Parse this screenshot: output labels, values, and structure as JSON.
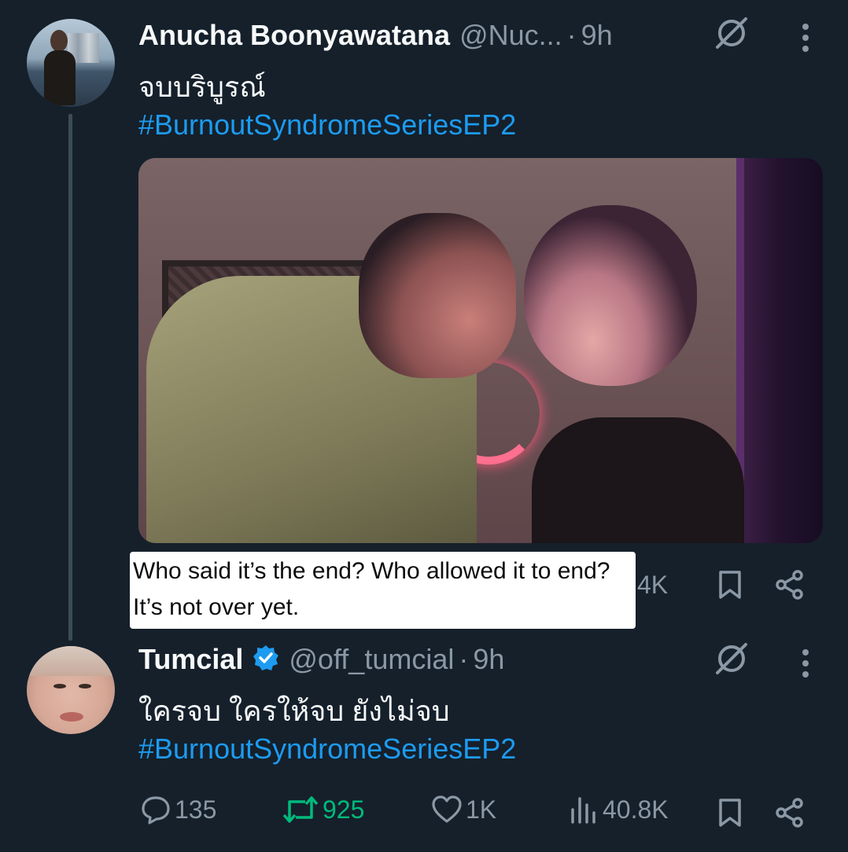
{
  "tweet1": {
    "display_name": "Anucha Boonyawatana",
    "handle": "@Nuc...",
    "separator": "·",
    "time": "9h",
    "text": "จบบริบูรณ์",
    "hashtag": "#BurnoutSyndromeSeriesEP2",
    "partial_stat": "4K"
  },
  "translation_overlay": {
    "text": "Who said it’s the end? Who allowed it to end? It’s not over yet."
  },
  "tweet2": {
    "display_name": "Tumcial",
    "handle": "@off_tumcial",
    "separator": "·",
    "time": "9h",
    "text": "ใครจบ ใครให้จบ ยังไม่จบ",
    "hashtag": "#BurnoutSyndromeSeriesEP2",
    "replies": "135",
    "reposts": "925",
    "likes": "1K",
    "views": "40.8K"
  },
  "colors": {
    "background": "#15202b",
    "text": "#f7f9f9",
    "secondary": "#8b98a5",
    "link": "#1d9bf0",
    "repost_active": "#00ba7c"
  }
}
